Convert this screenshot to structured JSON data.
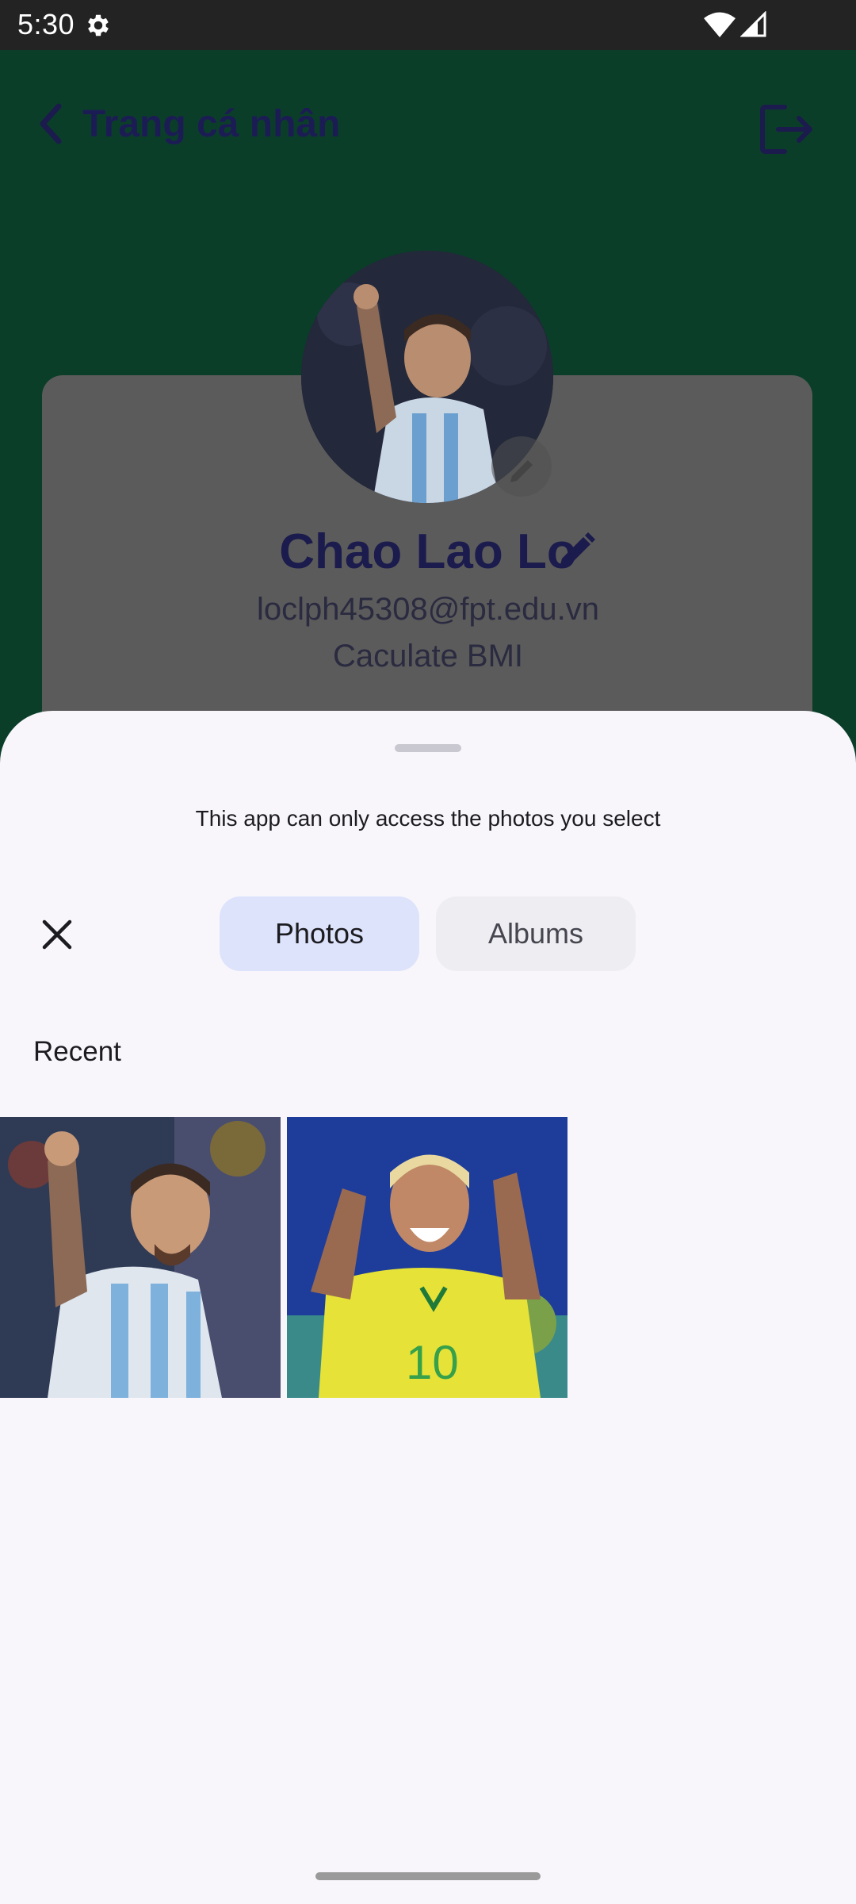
{
  "status_bar": {
    "time": "5:30",
    "settings_icon": "gear-icon",
    "wifi_icon": "wifi-icon",
    "signal_icon": "cell-signal-icon"
  },
  "app": {
    "title": "Trang cá nhân",
    "back_icon": "chevron-left-icon",
    "logout_icon": "logout-icon",
    "profile": {
      "name": "Chao Lao Lo",
      "email": "loclph45308@fpt.edu.vn",
      "bmi_link": "Caculate BMI"
    },
    "colors": {
      "background": "#0b3e29",
      "title": "#1c1c55"
    }
  },
  "picker": {
    "message": "This app can only access the photos you select",
    "close_icon": "close-icon",
    "tabs": [
      {
        "label": "Photos",
        "selected": true
      },
      {
        "label": "Albums",
        "selected": false
      }
    ],
    "section_label": "Recent",
    "photos": [
      {
        "name": "photo-messi-celebrating"
      },
      {
        "name": "photo-neymar-celebrating"
      }
    ],
    "colors": {
      "sheet": "#f8f6fb",
      "tab_selected": "#dce3fb",
      "tab_unselected": "#eeedf2"
    }
  }
}
